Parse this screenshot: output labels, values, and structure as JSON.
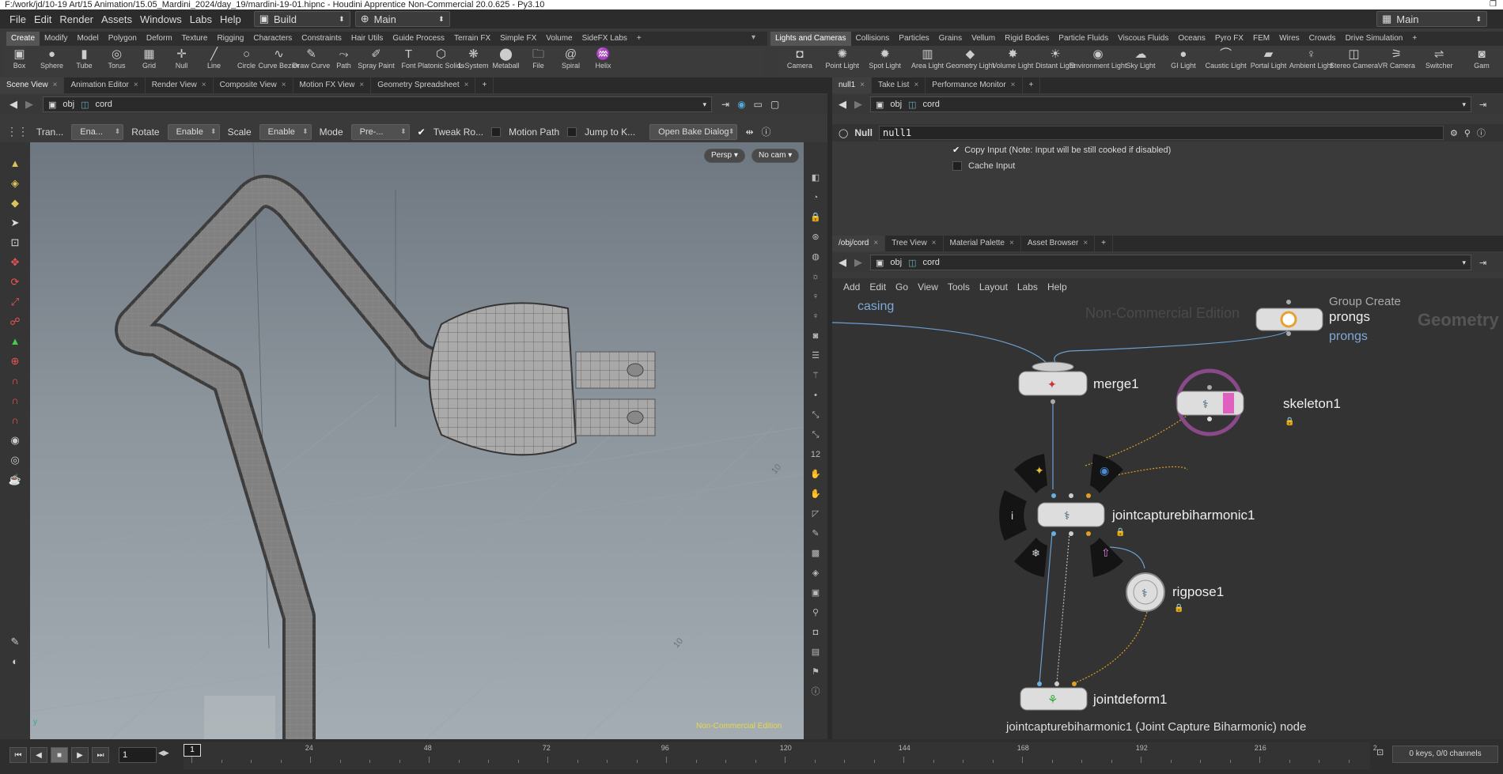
{
  "title": "F:/work/jd/10-19 Art/15 Animation/15.05_Mardini_2024/day_19/mardini-19-01.hipnc - Houdini Apprentice Non-Commercial 20.0.625 - Py3.10",
  "menu": [
    "File",
    "Edit",
    "Render",
    "Assets",
    "Windows",
    "Labs",
    "Help"
  ],
  "desktop_build": "Build",
  "desktop_main": "Main",
  "desktop_main_right": "Main",
  "shelf_tabs_left": [
    "Create",
    "Modify",
    "Model",
    "Polygon",
    "Deform",
    "Texture",
    "Rigging",
    "Characters",
    "Constraints",
    "Hair Utils",
    "Guide Process",
    "Terrain FX",
    "Simple FX",
    "Volume",
    "SideFX Labs"
  ],
  "shelf_tabs_right": [
    "Lights and Cameras",
    "Collisions",
    "Particles",
    "Grains",
    "Vellum",
    "Rigid Bodies",
    "Particle Fluids",
    "Viscous Fluids",
    "Oceans",
    "Pyro FX",
    "FEM",
    "Wires",
    "Crowds",
    "Drive Simulation"
  ],
  "tools_left": [
    {
      "l": "Box",
      "i": "▣"
    },
    {
      "l": "Sphere",
      "i": "●"
    },
    {
      "l": "Tube",
      "i": "▮"
    },
    {
      "l": "Torus",
      "i": "◎"
    },
    {
      "l": "Grid",
      "i": "▦"
    },
    {
      "l": "Null",
      "i": "✛"
    },
    {
      "l": "Line",
      "i": "╱"
    },
    {
      "l": "Circle",
      "i": "○"
    },
    {
      "l": "Curve Bezier",
      "i": "∿"
    },
    {
      "l": "Draw Curve",
      "i": "✎"
    },
    {
      "l": "Path",
      "i": "⤳"
    },
    {
      "l": "Spray Paint",
      "i": "✐"
    },
    {
      "l": "Font",
      "i": "T"
    },
    {
      "l": "Platonic Solids",
      "i": "⬡"
    },
    {
      "l": "L-System",
      "i": "❋"
    },
    {
      "l": "Metaball",
      "i": "⬤"
    },
    {
      "l": "File",
      "i": "🗀"
    },
    {
      "l": "Spiral",
      "i": "@"
    },
    {
      "l": "Helix",
      "i": "♒"
    }
  ],
  "tools_right": [
    {
      "l": "Camera",
      "i": "◘"
    },
    {
      "l": "Point Light",
      "i": "✺"
    },
    {
      "l": "Spot Light",
      "i": "✹"
    },
    {
      "l": "Area Light",
      "i": "▥"
    },
    {
      "l": "Geometry Light",
      "i": "◆"
    },
    {
      "l": "Volume Light",
      "i": "✸"
    },
    {
      "l": "Distant Light",
      "i": "☀"
    },
    {
      "l": "Environment Light",
      "i": "◉"
    },
    {
      "l": "Sky Light",
      "i": "☁"
    },
    {
      "l": "GI Light",
      "i": "●"
    },
    {
      "l": "Caustic Light",
      "i": "⌒"
    },
    {
      "l": "Portal Light",
      "i": "▰"
    },
    {
      "l": "Ambient Light",
      "i": "♀"
    },
    {
      "l": "Stereo Camera",
      "i": "◫"
    },
    {
      "l": "VR Camera",
      "i": "⚞"
    },
    {
      "l": "Switcher",
      "i": "⇌"
    },
    {
      "l": "Gam",
      "i": "◙"
    }
  ],
  "scene_tabs": [
    "Scene View",
    "Animation Editor",
    "Render View",
    "Composite View",
    "Motion FX View",
    "Geometry Spreadsheet"
  ],
  "path_obj": "obj",
  "path_cord": "cord",
  "param_tabs": [
    "null1",
    "Take List",
    "Performance Monitor"
  ],
  "vp_toolbar": {
    "tran": "Tran...",
    "ena": "Ena...",
    "rotate": "Rotate",
    "enable1": "Enable",
    "scale": "Scale",
    "enable2": "Enable",
    "mode": "Mode",
    "pre": "Pre-...",
    "tweak": "Tweak Ro...",
    "motion": "Motion Path",
    "jump": "Jump to K...",
    "bake": "Open Bake Dialog"
  },
  "persp": "Persp",
  "nocam": "No cam",
  "watermark": "Non-Commercial Edition",
  "null_type": "Null",
  "null_name": "null1",
  "copy_input": "Copy Input (Note: Input will be still cooked if disabled)",
  "cache_input": "Cache Input",
  "net_tabs": [
    "/obj/cord",
    "Tree View",
    "Material Palette",
    "Asset Browser"
  ],
  "net_menu": [
    "Add",
    "Edit",
    "Go",
    "View",
    "Tools",
    "Layout",
    "Labs",
    "Help"
  ],
  "nodes": {
    "casing": "casing",
    "group_create": "Group Create",
    "prongs": "prongs",
    "prongs_label": "prongs",
    "nc_edition": "Non-Commercial Edition",
    "geometry": "Geometry",
    "merge": "merge1",
    "skeleton": "skeleton1",
    "jcb": "jointcapturebiharmonic1",
    "rigpose": "rigpose1",
    "jointdeform": "jointdeform1",
    "status": "jointcapturebiharmonic1 (Joint Capture Biharmonic) node"
  },
  "timeline": {
    "frame": "1",
    "frame_marker": "1",
    "ticks": [
      "24",
      "48",
      "72",
      "96",
      "120",
      "144",
      "168",
      "192",
      "216",
      "2"
    ],
    "keys": "0 keys, 0/0 channels"
  },
  "axis_labels": [
    "10",
    "10"
  ]
}
